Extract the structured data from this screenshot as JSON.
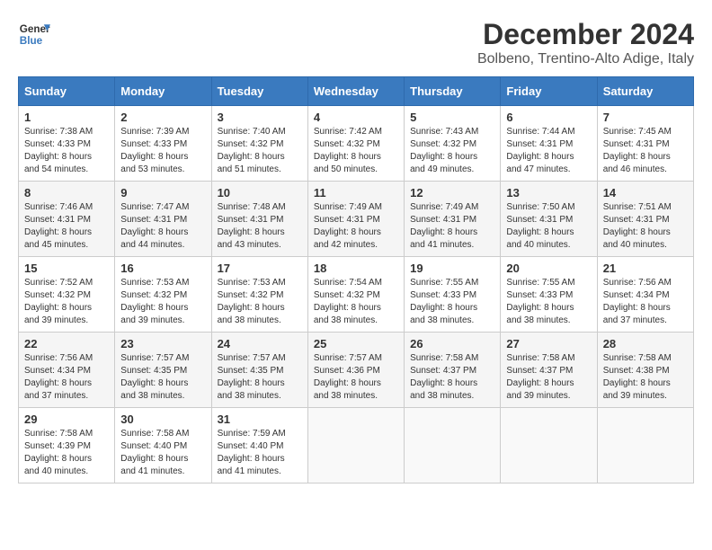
{
  "header": {
    "logo_line1": "General",
    "logo_line2": "Blue",
    "main_title": "December 2024",
    "subtitle": "Bolbeno, Trentino-Alto Adige, Italy"
  },
  "calendar": {
    "days_of_week": [
      "Sunday",
      "Monday",
      "Tuesday",
      "Wednesday",
      "Thursday",
      "Friday",
      "Saturday"
    ],
    "weeks": [
      [
        {
          "day": "1",
          "sunrise": "Sunrise: 7:38 AM",
          "sunset": "Sunset: 4:33 PM",
          "daylight": "Daylight: 8 hours and 54 minutes."
        },
        {
          "day": "2",
          "sunrise": "Sunrise: 7:39 AM",
          "sunset": "Sunset: 4:33 PM",
          "daylight": "Daylight: 8 hours and 53 minutes."
        },
        {
          "day": "3",
          "sunrise": "Sunrise: 7:40 AM",
          "sunset": "Sunset: 4:32 PM",
          "daylight": "Daylight: 8 hours and 51 minutes."
        },
        {
          "day": "4",
          "sunrise": "Sunrise: 7:42 AM",
          "sunset": "Sunset: 4:32 PM",
          "daylight": "Daylight: 8 hours and 50 minutes."
        },
        {
          "day": "5",
          "sunrise": "Sunrise: 7:43 AM",
          "sunset": "Sunset: 4:32 PM",
          "daylight": "Daylight: 8 hours and 49 minutes."
        },
        {
          "day": "6",
          "sunrise": "Sunrise: 7:44 AM",
          "sunset": "Sunset: 4:31 PM",
          "daylight": "Daylight: 8 hours and 47 minutes."
        },
        {
          "day": "7",
          "sunrise": "Sunrise: 7:45 AM",
          "sunset": "Sunset: 4:31 PM",
          "daylight": "Daylight: 8 hours and 46 minutes."
        }
      ],
      [
        {
          "day": "8",
          "sunrise": "Sunrise: 7:46 AM",
          "sunset": "Sunset: 4:31 PM",
          "daylight": "Daylight: 8 hours and 45 minutes."
        },
        {
          "day": "9",
          "sunrise": "Sunrise: 7:47 AM",
          "sunset": "Sunset: 4:31 PM",
          "daylight": "Daylight: 8 hours and 44 minutes."
        },
        {
          "day": "10",
          "sunrise": "Sunrise: 7:48 AM",
          "sunset": "Sunset: 4:31 PM",
          "daylight": "Daylight: 8 hours and 43 minutes."
        },
        {
          "day": "11",
          "sunrise": "Sunrise: 7:49 AM",
          "sunset": "Sunset: 4:31 PM",
          "daylight": "Daylight: 8 hours and 42 minutes."
        },
        {
          "day": "12",
          "sunrise": "Sunrise: 7:49 AM",
          "sunset": "Sunset: 4:31 PM",
          "daylight": "Daylight: 8 hours and 41 minutes."
        },
        {
          "day": "13",
          "sunrise": "Sunrise: 7:50 AM",
          "sunset": "Sunset: 4:31 PM",
          "daylight": "Daylight: 8 hours and 40 minutes."
        },
        {
          "day": "14",
          "sunrise": "Sunrise: 7:51 AM",
          "sunset": "Sunset: 4:31 PM",
          "daylight": "Daylight: 8 hours and 40 minutes."
        }
      ],
      [
        {
          "day": "15",
          "sunrise": "Sunrise: 7:52 AM",
          "sunset": "Sunset: 4:32 PM",
          "daylight": "Daylight: 8 hours and 39 minutes."
        },
        {
          "day": "16",
          "sunrise": "Sunrise: 7:53 AM",
          "sunset": "Sunset: 4:32 PM",
          "daylight": "Daylight: 8 hours and 39 minutes."
        },
        {
          "day": "17",
          "sunrise": "Sunrise: 7:53 AM",
          "sunset": "Sunset: 4:32 PM",
          "daylight": "Daylight: 8 hours and 38 minutes."
        },
        {
          "day": "18",
          "sunrise": "Sunrise: 7:54 AM",
          "sunset": "Sunset: 4:32 PM",
          "daylight": "Daylight: 8 hours and 38 minutes."
        },
        {
          "day": "19",
          "sunrise": "Sunrise: 7:55 AM",
          "sunset": "Sunset: 4:33 PM",
          "daylight": "Daylight: 8 hours and 38 minutes."
        },
        {
          "day": "20",
          "sunrise": "Sunrise: 7:55 AM",
          "sunset": "Sunset: 4:33 PM",
          "daylight": "Daylight: 8 hours and 38 minutes."
        },
        {
          "day": "21",
          "sunrise": "Sunrise: 7:56 AM",
          "sunset": "Sunset: 4:34 PM",
          "daylight": "Daylight: 8 hours and 37 minutes."
        }
      ],
      [
        {
          "day": "22",
          "sunrise": "Sunrise: 7:56 AM",
          "sunset": "Sunset: 4:34 PM",
          "daylight": "Daylight: 8 hours and 37 minutes."
        },
        {
          "day": "23",
          "sunrise": "Sunrise: 7:57 AM",
          "sunset": "Sunset: 4:35 PM",
          "daylight": "Daylight: 8 hours and 38 minutes."
        },
        {
          "day": "24",
          "sunrise": "Sunrise: 7:57 AM",
          "sunset": "Sunset: 4:35 PM",
          "daylight": "Daylight: 8 hours and 38 minutes."
        },
        {
          "day": "25",
          "sunrise": "Sunrise: 7:57 AM",
          "sunset": "Sunset: 4:36 PM",
          "daylight": "Daylight: 8 hours and 38 minutes."
        },
        {
          "day": "26",
          "sunrise": "Sunrise: 7:58 AM",
          "sunset": "Sunset: 4:37 PM",
          "daylight": "Daylight: 8 hours and 38 minutes."
        },
        {
          "day": "27",
          "sunrise": "Sunrise: 7:58 AM",
          "sunset": "Sunset: 4:37 PM",
          "daylight": "Daylight: 8 hours and 39 minutes."
        },
        {
          "day": "28",
          "sunrise": "Sunrise: 7:58 AM",
          "sunset": "Sunset: 4:38 PM",
          "daylight": "Daylight: 8 hours and 39 minutes."
        }
      ],
      [
        {
          "day": "29",
          "sunrise": "Sunrise: 7:58 AM",
          "sunset": "Sunset: 4:39 PM",
          "daylight": "Daylight: 8 hours and 40 minutes."
        },
        {
          "day": "30",
          "sunrise": "Sunrise: 7:58 AM",
          "sunset": "Sunset: 4:40 PM",
          "daylight": "Daylight: 8 hours and 41 minutes."
        },
        {
          "day": "31",
          "sunrise": "Sunrise: 7:59 AM",
          "sunset": "Sunset: 4:40 PM",
          "daylight": "Daylight: 8 hours and 41 minutes."
        },
        null,
        null,
        null,
        null
      ]
    ]
  }
}
